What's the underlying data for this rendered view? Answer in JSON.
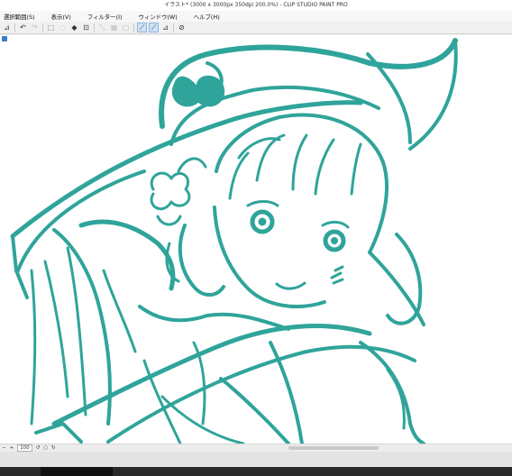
{
  "window": {
    "title": "イラスト* (3000 x 3000px 350dpi 200.0%)  - CLIP STUDIO PAINT PRO"
  },
  "menu": [
    "選択範囲(S)",
    "表示(V)",
    "フィルター(I)",
    "ウィンドウ(W)",
    "ヘルプ(H)"
  ],
  "toolbar": {
    "icons": [
      "layer-property-icon",
      "undo-icon",
      "redo-icon",
      "clear-selection-icon",
      "crop-icon",
      "fill-icon",
      "transform-icon",
      "snap-ruler-icon",
      "snap-grid-icon",
      "snap-special-icon",
      "stabilization-icon",
      "eraser-icon",
      "vector-icon",
      "lasso-fill-icon"
    ]
  },
  "status": {
    "zoom": "100"
  },
  "colors": {
    "line_art": "#2fa49a",
    "canvas": "#ffffff",
    "chrome": "#f0f0f0",
    "accent": "#3b7bd1"
  }
}
